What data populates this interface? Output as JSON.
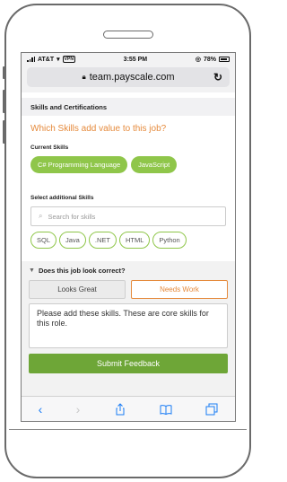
{
  "status": {
    "carrier": "AT&T",
    "vpn": "VPN",
    "time": "3:55 PM",
    "battery": "78%"
  },
  "browser": {
    "url": "team.payscale.com"
  },
  "section": {
    "title": "Skills and Certifications",
    "question": "Which Skills add value to this job?",
    "current_label": "Current Skills",
    "current_skills": [
      "C# Programming Language",
      "JavaScript"
    ],
    "select_label": "Select additional Skills",
    "search_placeholder": "Search for skills",
    "additional_skills": [
      "SQL",
      "Java",
      ".NET",
      "HTML",
      "Python"
    ]
  },
  "feedback": {
    "title": "Does this job look correct?",
    "looks_great": "Looks Great",
    "needs_work": "Needs Work",
    "comment": "Please add these skills. These are core skills for this role.",
    "submit": "Submit Feedback"
  },
  "colors": {
    "accent_orange": "#e58a3c",
    "chip_green": "#8fc64a",
    "submit_green": "#6ea637",
    "ios_blue": "#1a7cf5"
  }
}
